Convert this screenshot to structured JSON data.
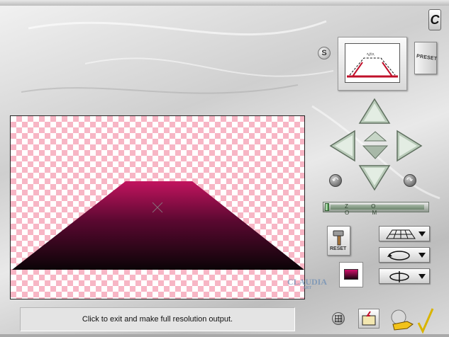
{
  "preset_button": {
    "label": "PRESET"
  },
  "reset_button": {
    "label": "RESET"
  },
  "zoom": {
    "label": "Z O O M",
    "value": 0.0
  },
  "status": {
    "text": "Click to exit and make full resolution output."
  },
  "watermark": {
    "text": "CLAUDIA",
    "sub": "ART"
  },
  "colors": {
    "plane_top": "#c2145f",
    "plane_bottom": "#0b0407",
    "checker_pink": "#f7b6c5",
    "frame_silver": "#d0d0d0"
  },
  "icons": [
    "logo-c-icon",
    "s-icon",
    "arrow-up-icon",
    "arrow-down-icon",
    "arrow-left-icon",
    "arrow-right-icon",
    "center-up-icon",
    "center-down-icon",
    "rotate-left-icon",
    "rotate-right-icon",
    "hammer-icon",
    "grid-plane-icon",
    "rotate-ring-icon",
    "flip-icon",
    "grid-icon",
    "folder-icon",
    "pointing-hand-check-icon"
  ]
}
